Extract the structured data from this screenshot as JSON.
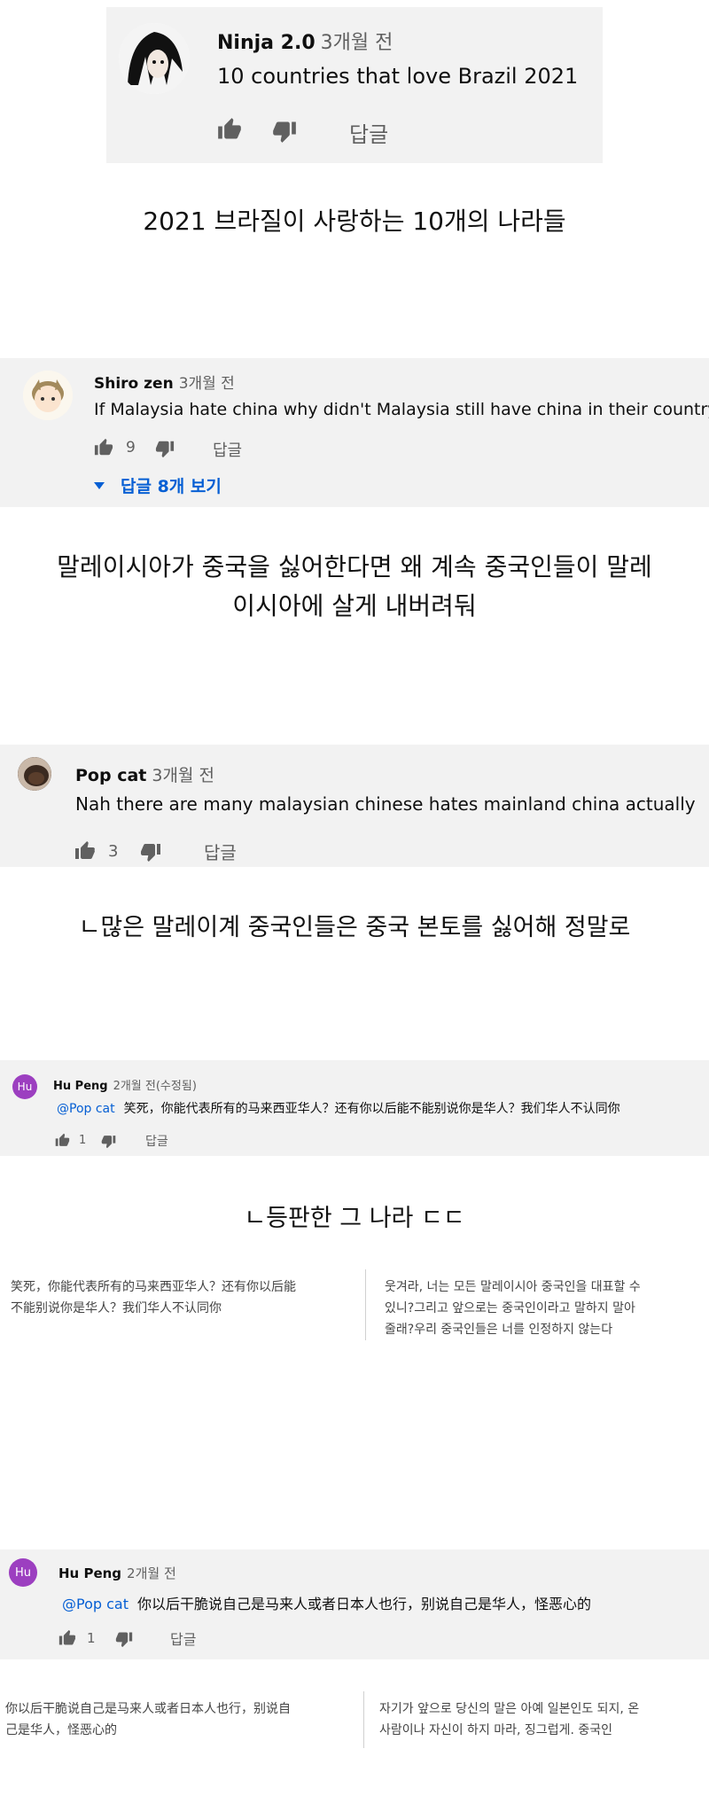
{
  "blocks": [
    {
      "author": "Ninja 2.0",
      "time": "3개월 전",
      "comment": "10 countries that love Brazil 2021",
      "likes": "",
      "reply_label": "답글"
    },
    {
      "author": "Shiro zen",
      "time": "3개월 전",
      "comment": "If Malaysia hate china why didn't Malaysia still have china in their country",
      "likes": "9",
      "reply_label": "답글",
      "view_replies": "답글 8개 보기"
    },
    {
      "author": "Pop cat",
      "time": "3개월 전",
      "comment": "Nah there are many malaysian chinese hates mainland china actually",
      "likes": "3",
      "reply_label": "답글"
    },
    {
      "author": "Hu Peng",
      "time": "2개월 전(수정됨)",
      "mention": "@Pop cat",
      "comment": "笑死，你能代表所有的马来西亚华人？还有你以后能不能别说你是华人？我们华人不认同你",
      "likes": "1",
      "reply_label": "답글",
      "avatar_letters": "Hu"
    },
    {
      "author": "Hu Peng",
      "time": "2개월 전",
      "mention": "@Pop cat",
      "comment": "你以后干脆说自己是马来人或者日本人也行，别说自己是华人，怪恶心的",
      "likes": "1",
      "reply_label": "답글",
      "avatar_letters": "Hu"
    }
  ],
  "captions": {
    "c1": "2021 브라질이 사랑하는 10개의 나라들",
    "c2_line1": "말레이시아가 중국을 싫어한다면 왜 계속 중국인들이 말레",
    "c2_line2": "이시아에 살게 내버려둬",
    "c3": "ㄴ많은 말레이계 중국인들은 중국 본토를 싫어해 정말로",
    "c4": "ㄴ등판한 그 나라 ㄷㄷ"
  },
  "translations": [
    {
      "left_line1": "笑死，你能代表所有的马来西亚华人？还有你以后能",
      "left_line2": "不能别说你是华人？我们华人不认同你",
      "right_line1": "웃겨라, 너는 모든 말레이시아 중국인을 대표할 수",
      "right_line2": "있니?그리고 앞으로는 중국인이라고 말하지 말아",
      "right_line3": "줄래?우리 중국인들은 너를 인정하지 않는다"
    },
    {
      "left_line1": "你以后干脆说自己是马来人或者日本人也行，别说自",
      "left_line2": "己是华人，怪恶心的",
      "right_line1": "자기가 앞으로 당신의 말은 아예 일본인도 되지, 온",
      "right_line2": "사람이나 자신이 하지 마라, 징그럽게. 중국인"
    }
  ],
  "colors": {
    "gray_bg": "#f2f2f2",
    "link_blue": "#065fd4",
    "avatar_purple": "#9c3fc0",
    "meta_gray": "#606060"
  },
  "icons": [
    "thumbs-up-icon",
    "thumbs-down-icon",
    "caret-down-icon"
  ]
}
